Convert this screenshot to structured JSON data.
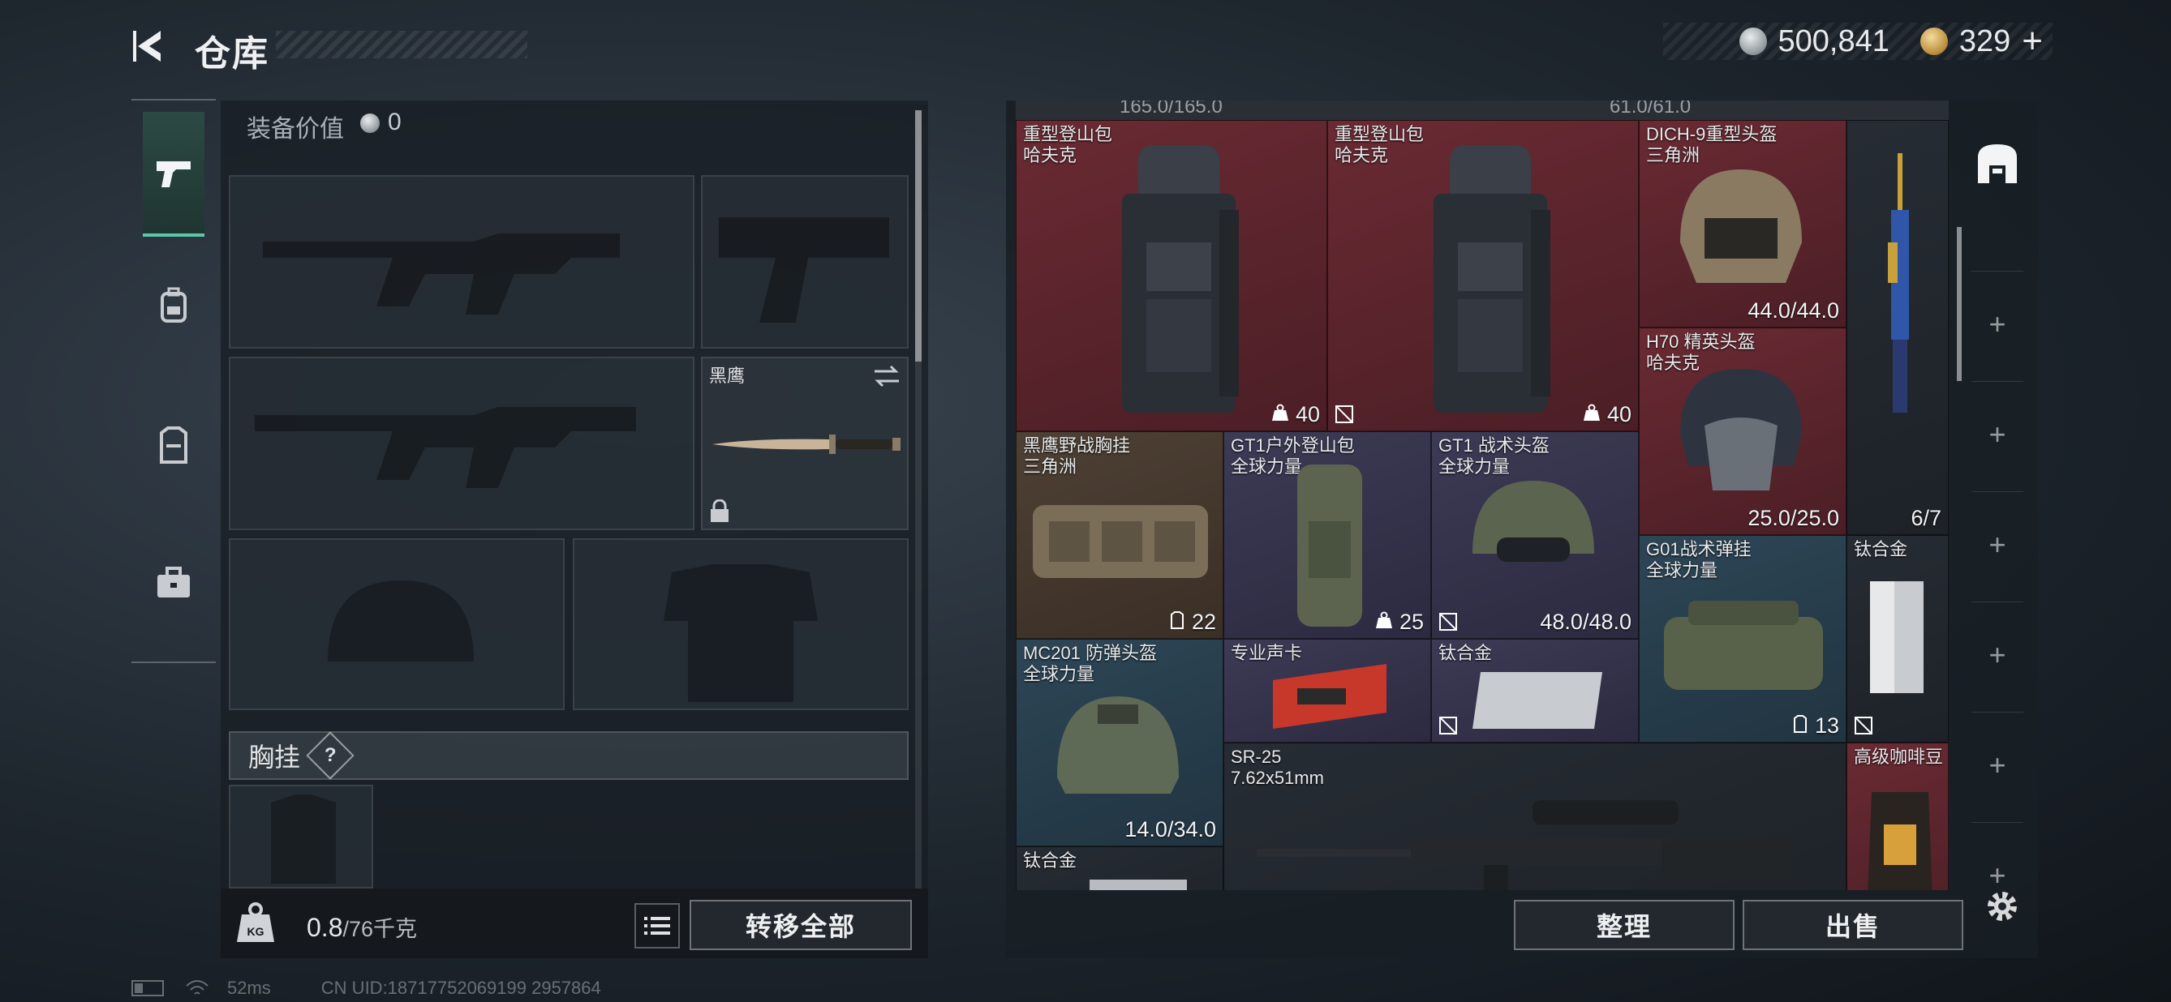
{
  "header": {
    "title": "仓库",
    "currency": [
      {
        "icon": "silver-coin-icon",
        "value": "500,841"
      },
      {
        "icon": "gold-coin-icon",
        "value": "329",
        "add": "+"
      }
    ]
  },
  "tabs": [
    {
      "icon": "pistol-icon",
      "active": true
    },
    {
      "icon": "backpack-icon",
      "active": false
    },
    {
      "icon": "vest-icon",
      "active": false
    },
    {
      "icon": "toolbox-icon",
      "active": false
    }
  ],
  "left": {
    "equip_value_label": "装备价值",
    "equip_value": "0",
    "knife_name": "黑鹰",
    "vest_label": "胸挂",
    "vest_help": "?",
    "weight_value": "0.8",
    "weight_unit": "/76千克",
    "transfer_all": "转移全部"
  },
  "grid": {
    "top_strip": [
      "165.0/165.0",
      "61.0/61.0"
    ],
    "items": [
      {
        "id": "backpack1",
        "name": "重型登山包",
        "sub": "哈夫克",
        "br": "40",
        "br_icon": "weight-icon"
      },
      {
        "id": "backpack2",
        "name": "重型登山包",
        "sub": "哈夫克",
        "br": "40",
        "br_icon": "weight-icon"
      },
      {
        "id": "helmet-dich9",
        "name": "DICH-9重型头盔",
        "sub": "三角洲",
        "br": "44.0/44.0"
      },
      {
        "id": "rifle-tall",
        "name": "",
        "sub": "",
        "br": "6/7"
      },
      {
        "id": "helmet-h70",
        "name": "H70 精英头盔",
        "sub": "哈夫克",
        "br": "25.0/25.0"
      },
      {
        "id": "chestrig",
        "name": "黑鹰野战胸挂",
        "sub": "三角洲",
        "br": "22",
        "br_icon": "vest-small-icon"
      },
      {
        "id": "gt1-backpack",
        "name": "GT1户外登山包",
        "sub": "全球力量",
        "br": "25",
        "br_icon": "weight-icon"
      },
      {
        "id": "gt1-helmet",
        "name": "GT1 战术头盔",
        "sub": "全球力量",
        "br": "48.0/48.0"
      },
      {
        "id": "g01-rig",
        "name": "G01战术弹挂",
        "sub": "全球力量",
        "br": "13",
        "br_icon": "vest-small-icon"
      },
      {
        "id": "titanium1",
        "name": "钛合金",
        "sub": "",
        "br": ""
      },
      {
        "id": "mc201",
        "name": "MC201 防弹头盔",
        "sub": "全球力量",
        "br": "14.0/34.0"
      },
      {
        "id": "gpu",
        "name": "专业声卡",
        "sub": "",
        "br": ""
      },
      {
        "id": "titanium2",
        "name": "钛合金",
        "sub": "",
        "br": ""
      },
      {
        "id": "sr25",
        "name": "SR-25",
        "sub": "7.62x51mm",
        "br": ""
      },
      {
        "id": "coffee",
        "name": "高级咖啡豆",
        "sub": "",
        "br": ""
      },
      {
        "id": "titanium3",
        "name": "钛合金",
        "sub": "",
        "br": ""
      }
    ]
  },
  "right_buttons": {
    "sort": "整理",
    "sell": "出售"
  },
  "side_slots": [
    "+",
    "+",
    "+",
    "+",
    "+",
    "+"
  ],
  "status": {
    "ping": "52ms",
    "uid": "CN UID:18717752069199 2957864"
  }
}
